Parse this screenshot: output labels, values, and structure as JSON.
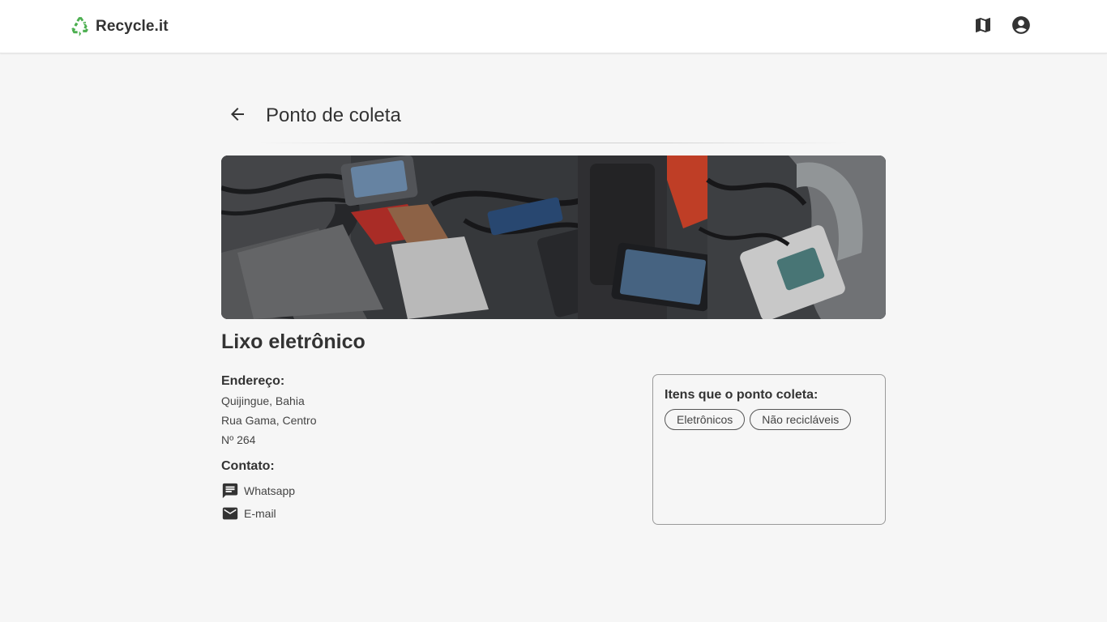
{
  "app": {
    "name": "Recycle.it",
    "brand_color": "#4caf50",
    "logo_icon": "recycle-icon"
  },
  "nav": {
    "map_icon": "map-icon",
    "account_icon": "account-circle-icon"
  },
  "page": {
    "title": "Ponto de coleta",
    "back_icon": "arrow-back-icon"
  },
  "point": {
    "name": "Lixo eletrônico",
    "image_alt": "electronic waste photo",
    "address_label": "Endereço:",
    "address_lines": [
      "Quijingue, Bahia",
      "Rua Gama, Centro",
      "Nº 264"
    ],
    "contact_label": "Contato:",
    "contacts": [
      {
        "icon": "chat-icon",
        "label": "Whatsapp"
      },
      {
        "icon": "mail-icon",
        "label": "E-mail"
      }
    ]
  },
  "items_card": {
    "title": "Itens que o ponto coleta:",
    "chips": [
      "Eletrônicos",
      "Não recicláveis"
    ]
  }
}
